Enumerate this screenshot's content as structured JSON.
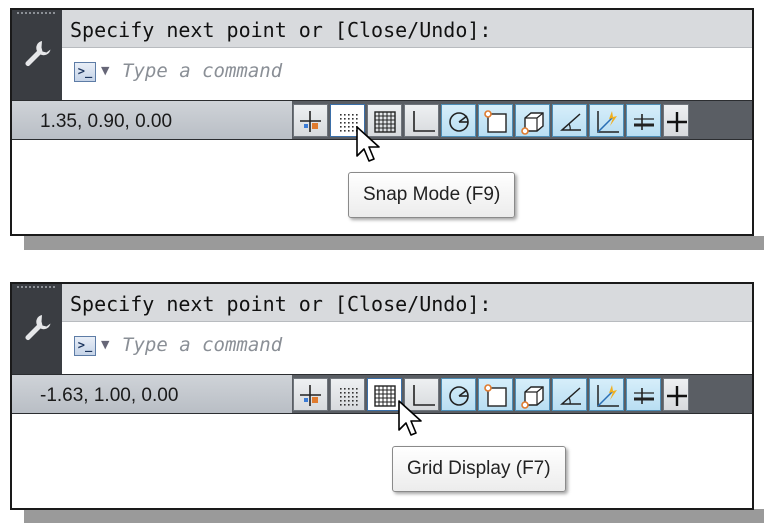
{
  "panels": [
    {
      "command_history": "Specify next point or [Close/Undo]:",
      "command_placeholder": "Type a command",
      "coordinates": "1.35, 0.90, 0.00",
      "tooltip": "Snap Mode (F9)",
      "hovered_button": "snap-mode"
    },
    {
      "command_history": "Specify next point or [Close/Undo]:",
      "command_placeholder": "Type a command",
      "coordinates": "-1.63, 1.00, 0.00",
      "tooltip": "Grid Display (F7)",
      "hovered_button": "grid-display"
    }
  ],
  "status_buttons": [
    {
      "name": "model-space",
      "icon": "crosshair-icon",
      "state": "off"
    },
    {
      "name": "snap-mode",
      "icon": "snap-dots-icon",
      "state": "off"
    },
    {
      "name": "grid-display",
      "icon": "grid-icon",
      "state": "off"
    },
    {
      "name": "ortho-mode",
      "icon": "ortho-icon",
      "state": "off"
    },
    {
      "name": "polar-tracking",
      "icon": "polar-icon",
      "state": "on"
    },
    {
      "name": "object-snap",
      "icon": "osnap-square-icon",
      "state": "on"
    },
    {
      "name": "3d-object-snap",
      "icon": "cube-icon",
      "state": "on"
    },
    {
      "name": "object-snap-tracking",
      "icon": "angle-icon",
      "state": "on"
    },
    {
      "name": "dynamic-ucs",
      "icon": "ucs-icon",
      "state": "on"
    },
    {
      "name": "lineweight",
      "icon": "lineweight-icon",
      "state": "on"
    },
    {
      "name": "more",
      "icon": "plus-icon",
      "state": "off"
    }
  ],
  "colors": {
    "status_bar": "#5a5e64",
    "active_button": "#b9def2",
    "command_history_bg": "#d8dadd"
  }
}
